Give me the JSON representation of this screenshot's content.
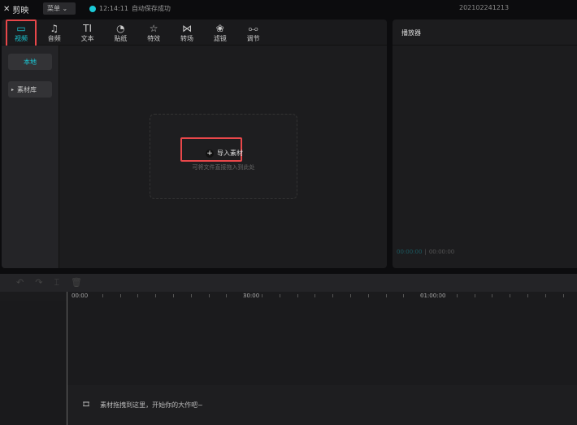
{
  "app": {
    "name": "剪映",
    "menu_label": "菜单",
    "save_time": "12:14:11",
    "save_status": "自动保存成功",
    "project_name": "202102241213"
  },
  "tabs": [
    {
      "label": "视频",
      "icon": "▭"
    },
    {
      "label": "音频",
      "icon": "♫"
    },
    {
      "label": "文本",
      "icon": "TI"
    },
    {
      "label": "贴纸",
      "icon": "◔"
    },
    {
      "label": "特效",
      "icon": "☆"
    },
    {
      "label": "转场",
      "icon": "⋈"
    },
    {
      "label": "滤镜",
      "icon": "❀"
    },
    {
      "label": "调节",
      "icon": "⧟"
    }
  ],
  "sidebar": {
    "local": "本地",
    "library": "素材库"
  },
  "import": {
    "label": "导入素材",
    "hint": "可将文件直接拖入到此处"
  },
  "player": {
    "title": "播放器",
    "current_time": "00:00:00",
    "total_time": "00:00:00"
  },
  "timeline": {
    "ruler": [
      "00:00",
      "30:00",
      "01:00:00"
    ],
    "empty_hint": "素材拖拽到这里，开始你的大作吧~"
  },
  "colors": {
    "accent": "#1bc9d6",
    "highlight": "#e8474a"
  }
}
